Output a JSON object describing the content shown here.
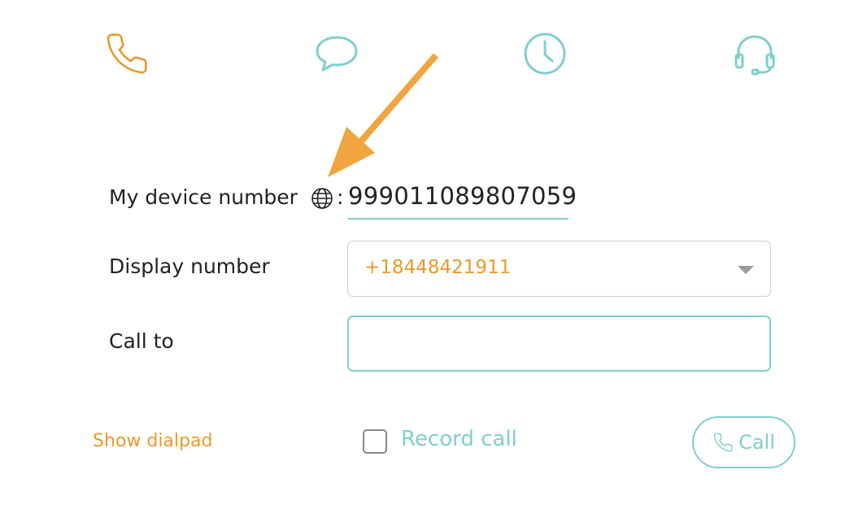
{
  "nav": {
    "tabs": [
      {
        "icon": "phone-icon",
        "color": "#e89a2c",
        "active": true
      },
      {
        "icon": "chat-bubble-icon",
        "color": "#7fcfcc",
        "active": false
      },
      {
        "icon": "clock-icon",
        "color": "#7fcfcc",
        "active": false
      },
      {
        "icon": "headset-icon",
        "color": "#7fcfcc",
        "active": false
      }
    ]
  },
  "annotation": {
    "icon": "arrow-annotation",
    "color": "#f0a540"
  },
  "device": {
    "label": "My device number",
    "globe_icon": "globe-icon",
    "separator": ":",
    "number": "999011089807059"
  },
  "display": {
    "label": "Display number",
    "selected_value": "+18448421911"
  },
  "call_to": {
    "label": "Call to",
    "value": "",
    "placeholder": ""
  },
  "footer": {
    "show_dialpad": "Show dialpad",
    "record_call": "Record call",
    "record_checked": false,
    "call_button": "Call"
  },
  "colors": {
    "accent_orange": "#e89a2c",
    "accent_teal": "#7fcfcc",
    "text": "#222222"
  }
}
